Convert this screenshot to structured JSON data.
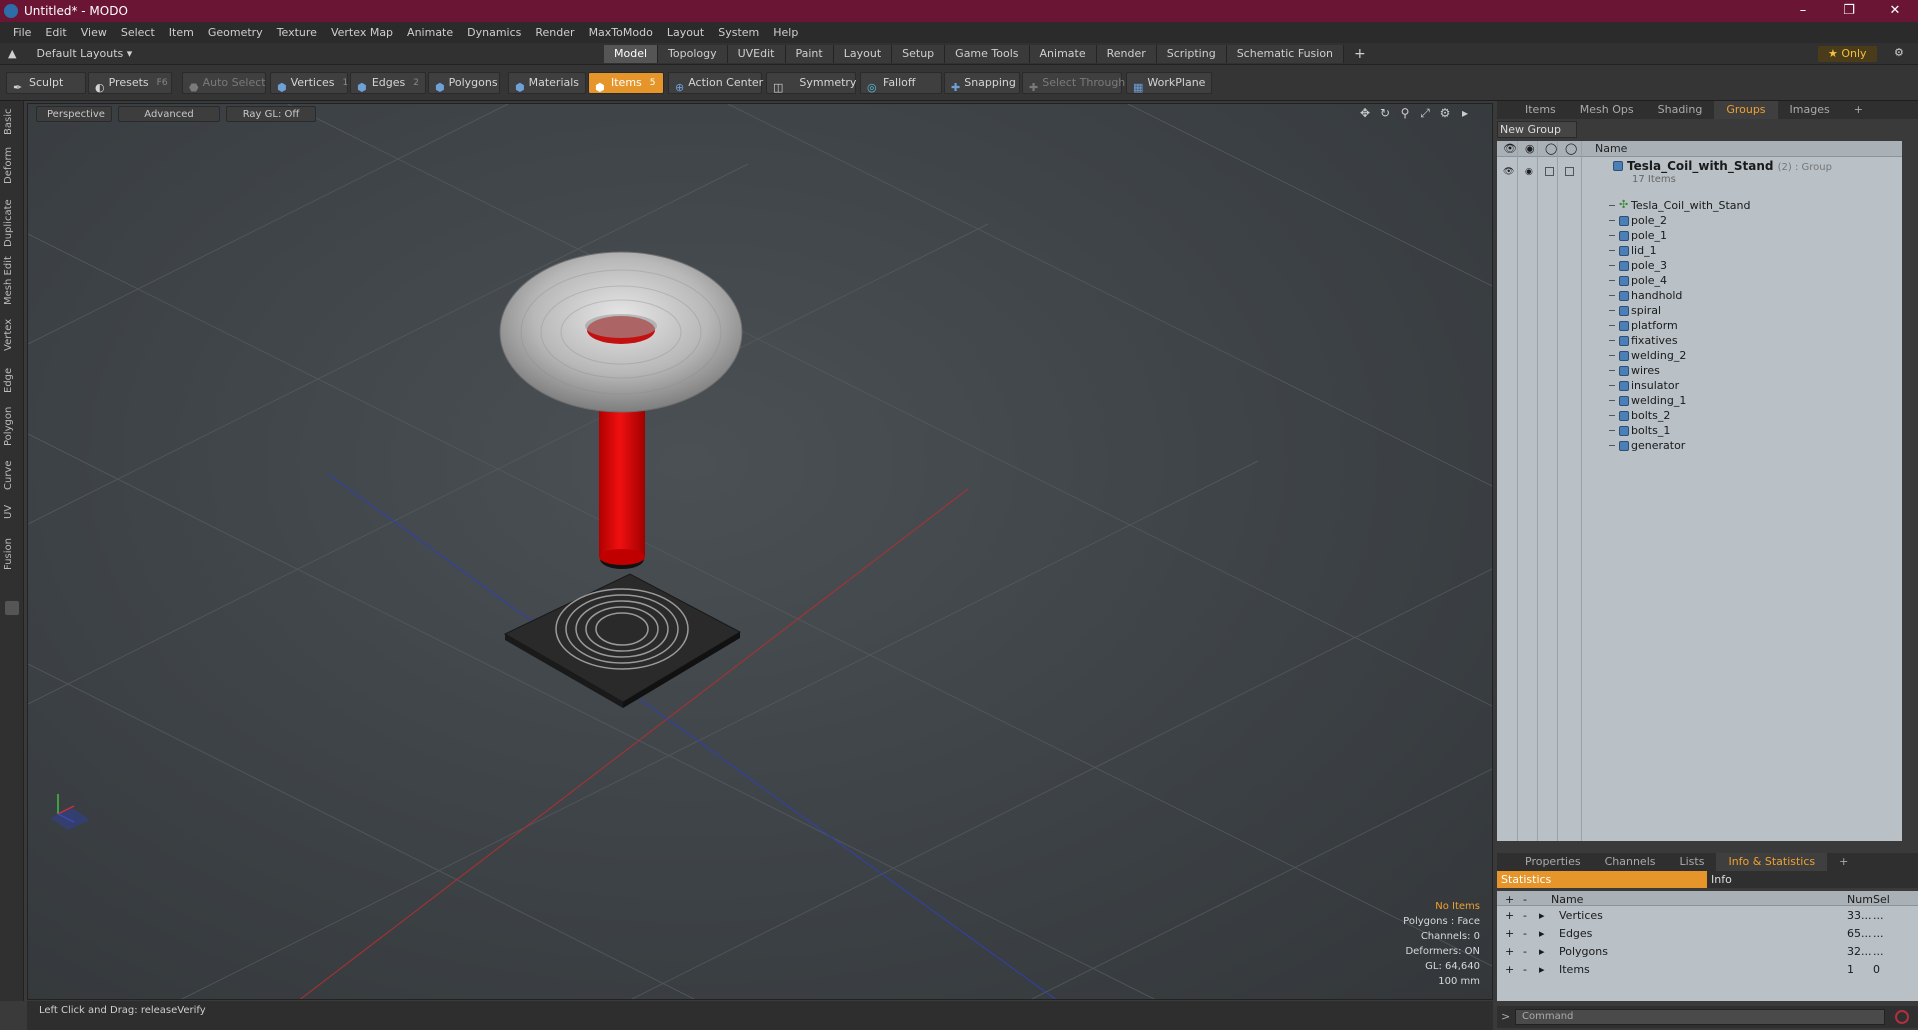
{
  "window": {
    "title": "Untitled* - MODO"
  },
  "menu": [
    "File",
    "Edit",
    "View",
    "Select",
    "Item",
    "Geometry",
    "Texture",
    "Vertex Map",
    "Animate",
    "Dynamics",
    "Render",
    "MaxToModo",
    "Layout",
    "System",
    "Help"
  ],
  "layout": {
    "selector": "Default Layouts ▾",
    "tabs": [
      "Model",
      "Topology",
      "UVEdit",
      "Paint",
      "Layout",
      "Setup",
      "Game Tools",
      "Animate",
      "Render",
      "Scripting",
      "Schematic Fusion"
    ],
    "active_tab": "Model",
    "only_label": "★ Only"
  },
  "toolbar": {
    "sculpt": "Sculpt",
    "presets": "Presets",
    "presets_key": "F6",
    "auto_select": "Auto Select",
    "vertices": "Vertices",
    "vertices_key": "1",
    "edges": "Edges",
    "edges_key": "2",
    "polygons": "Polygons",
    "materials": "Materials",
    "items": "Items",
    "items_key": "5",
    "action_center": "Action Center",
    "symmetry": "Symmetry",
    "falloff": "Falloff",
    "snapping": "Snapping",
    "select_through": "Select Through",
    "workplane": "WorkPlane"
  },
  "lefttabs": [
    "Basic",
    "Deform",
    "Duplicate",
    "Mesh Edit",
    "Vertex",
    "Edge",
    "Polygon",
    "Curve",
    "UV",
    "Fusion"
  ],
  "viewport": {
    "view": "Perspective",
    "shading": "Advanced",
    "raygl": "Ray GL: Off",
    "info": {
      "items": "No Items",
      "polygons": "Polygons : Face",
      "channels": "Channels: 0",
      "deformers": "Deformers: ON",
      "gl": "GL: 64,640",
      "scale": "100 mm"
    }
  },
  "status": {
    "text": "Left Click and Drag:   releaseVerify"
  },
  "panel_top": {
    "tabs": [
      "Items",
      "Mesh Ops",
      "Shading",
      "Groups",
      "Images"
    ],
    "active_tab": "Groups",
    "new_group": "New Group",
    "col_name": "Name",
    "group": {
      "name": "Tesla_Coil_with_Stand",
      "suffix": "(2) : Group",
      "count": "17 Items"
    },
    "items": [
      "Tesla_Coil_with_Stand",
      "pole_2",
      "pole_1",
      "lid_1",
      "pole_3",
      "pole_4",
      "handhold",
      "spiral",
      "platform",
      "fixatives",
      "welding_2",
      "wires",
      "insulator",
      "welding_1",
      "bolts_2",
      "bolts_1",
      "generator"
    ]
  },
  "panel_bottom": {
    "tabs": [
      "Properties",
      "Channels",
      "Lists",
      "Info & Statistics"
    ],
    "active_tab": "Info & Statistics",
    "stats_label": "Statistics",
    "info_label": "Info",
    "cols": {
      "name": "Name",
      "num": "Num",
      "sel": "Sel"
    },
    "rows": [
      {
        "name": "Vertices",
        "num": "33...",
        "sel": "..."
      },
      {
        "name": "Edges",
        "num": "65...",
        "sel": "..."
      },
      {
        "name": "Polygons",
        "num": "32...",
        "sel": "..."
      },
      {
        "name": "Items",
        "num": "1",
        "sel": "0"
      }
    ],
    "command_placeholder": "Command"
  },
  "colors": {
    "title_bar": "#6b1535",
    "accent": "#e6952a",
    "panel_tree": "#b9c0c6"
  }
}
